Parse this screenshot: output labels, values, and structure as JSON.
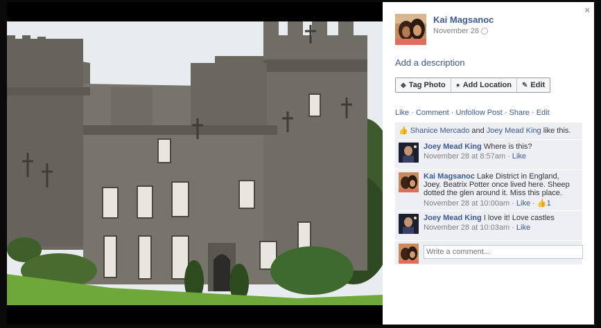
{
  "owner": {
    "name": "Kai Magsanoc",
    "date": "November 28"
  },
  "close_label": "×",
  "add_description": "Add a description",
  "actions": [
    {
      "label": "Tag Photo",
      "icon": "tag-icon"
    },
    {
      "label": "Add Location",
      "icon": "location-pin-icon"
    },
    {
      "label": "Edit",
      "icon": "pencil-icon"
    }
  ],
  "post_actions": {
    "like": "Like",
    "comment": "Comment",
    "unfollow": "Unfollow Post",
    "share": "Share",
    "edit": "Edit",
    "sep": "·"
  },
  "likes": {
    "user1": "Shanice Mercado",
    "and": "and",
    "user2": "Joey Mead King",
    "suffix": "like this."
  },
  "comments": [
    {
      "author": "Joey Mead King",
      "text": "Where is this?",
      "time": "November 28 at 8:57am",
      "like": "Like",
      "likes_count": ""
    },
    {
      "author": "Kai Magsanoc",
      "text": "Lake District in England, Joey. Beatrix Potter once lived here. Sheep dotted the glen around it. Miss this place.",
      "time": "November 28 at 10:00am",
      "like": "Like",
      "likes_count": "1"
    },
    {
      "author": "Joey Mead King",
      "text": "I love it! Love castles",
      "time": "November 28 at 10:03am",
      "like": "Like",
      "likes_count": ""
    }
  ],
  "comment_placeholder": "Write a comment...",
  "colors": {
    "link": "#3b5998",
    "feedback_bg": "#edeff4",
    "frame": "#0a0a0a"
  }
}
